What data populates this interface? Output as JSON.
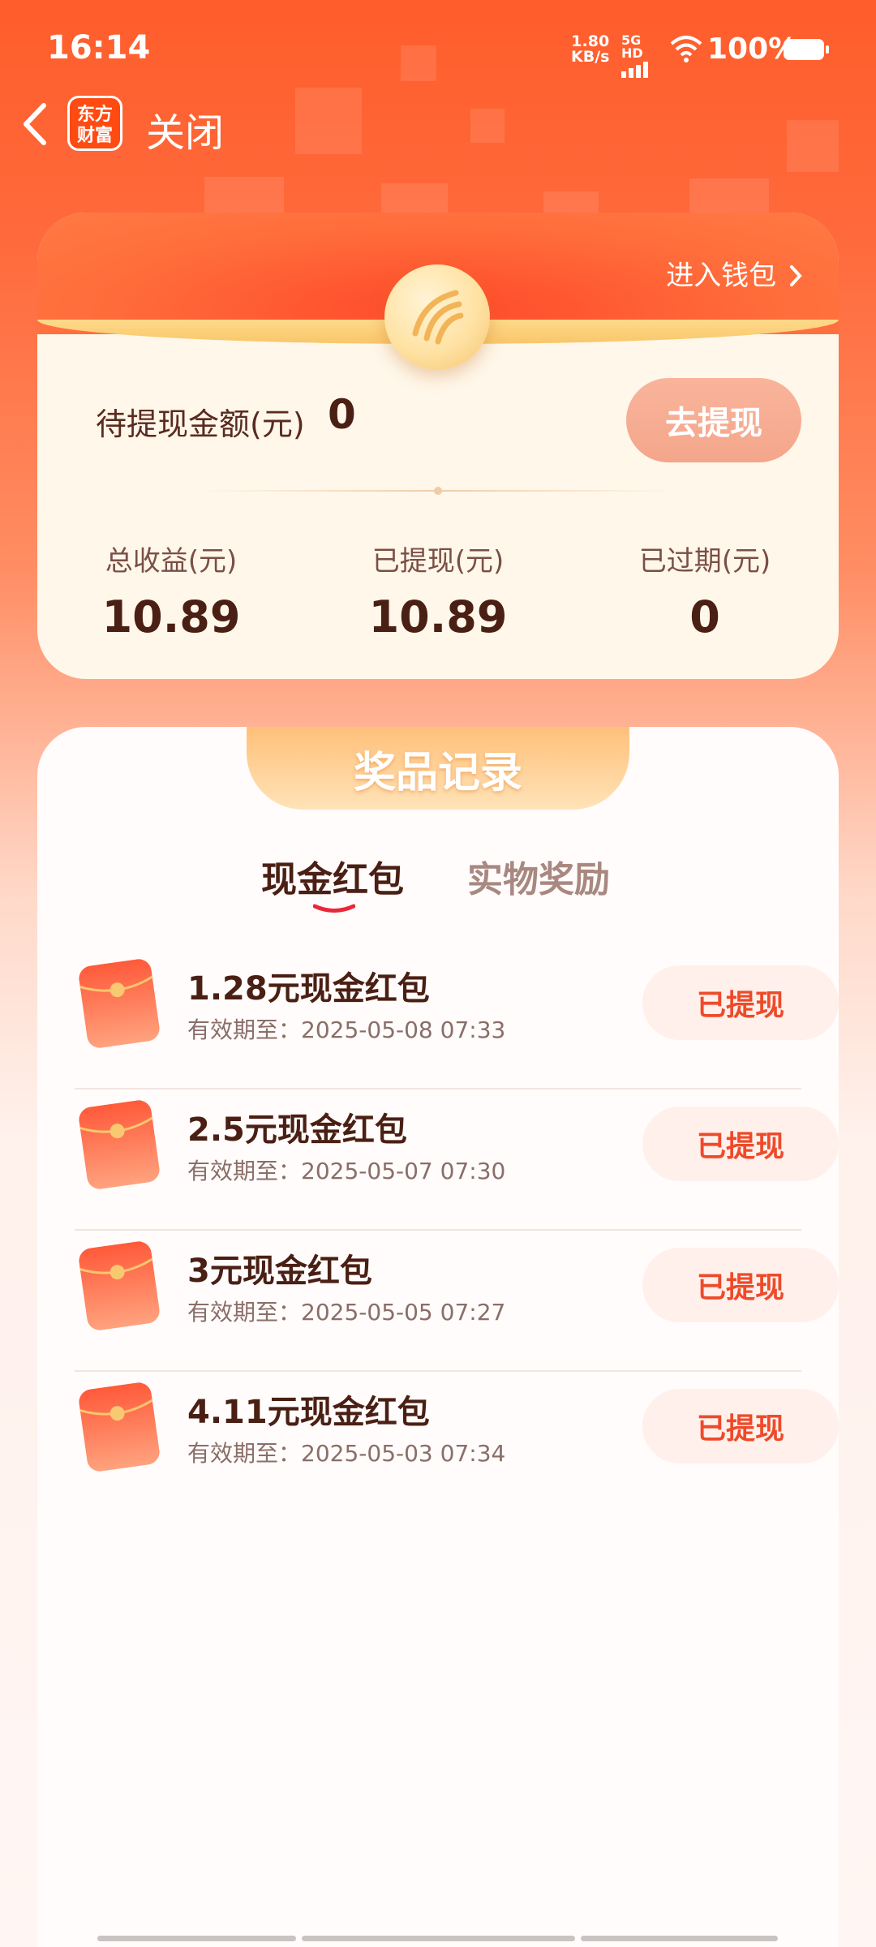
{
  "status_bar": {
    "time": "16:14",
    "net_speed_value": "1.80",
    "net_speed_unit": "KB/s",
    "net_type": "5G HD",
    "battery": "100%"
  },
  "nav": {
    "logo_line1": "东方",
    "logo_line2": "财富",
    "close_label": "关闭"
  },
  "wallet": {
    "link_label": "进入钱包",
    "pending_label": "待提现金额(元)",
    "pending_value": "0",
    "withdraw_button": "去提现",
    "stats": [
      {
        "label": "总收益(元)",
        "value": "10.89"
      },
      {
        "label": "已提现(元)",
        "value": "10.89"
      },
      {
        "label": "已过期(元)",
        "value": "0"
      }
    ]
  },
  "prizes": {
    "header": "奖品记录",
    "tabs": [
      {
        "label": "现金红包",
        "active": true
      },
      {
        "label": "实物奖励",
        "active": false
      }
    ],
    "items": [
      {
        "title": "1.28元现金红包",
        "expiry_label": "有效期至：",
        "expiry": "2025-05-08 07:33",
        "status": "已提现"
      },
      {
        "title": "2.5元现金红包",
        "expiry_label": "有效期至：",
        "expiry": "2025-05-07 07:30",
        "status": "已提现"
      },
      {
        "title": "3元现金红包",
        "expiry_label": "有效期至：",
        "expiry": "2025-05-05 07:27",
        "status": "已提现"
      },
      {
        "title": "4.11元现金红包",
        "expiry_label": "有效期至：",
        "expiry": "2025-05-03 07:34",
        "status": "已提现"
      }
    ]
  },
  "colors": {
    "brand_orange": "#ff5d2b",
    "accent_red": "#ee4a2a",
    "text_dark": "#4a1f14",
    "gold": "#f8c66a"
  }
}
